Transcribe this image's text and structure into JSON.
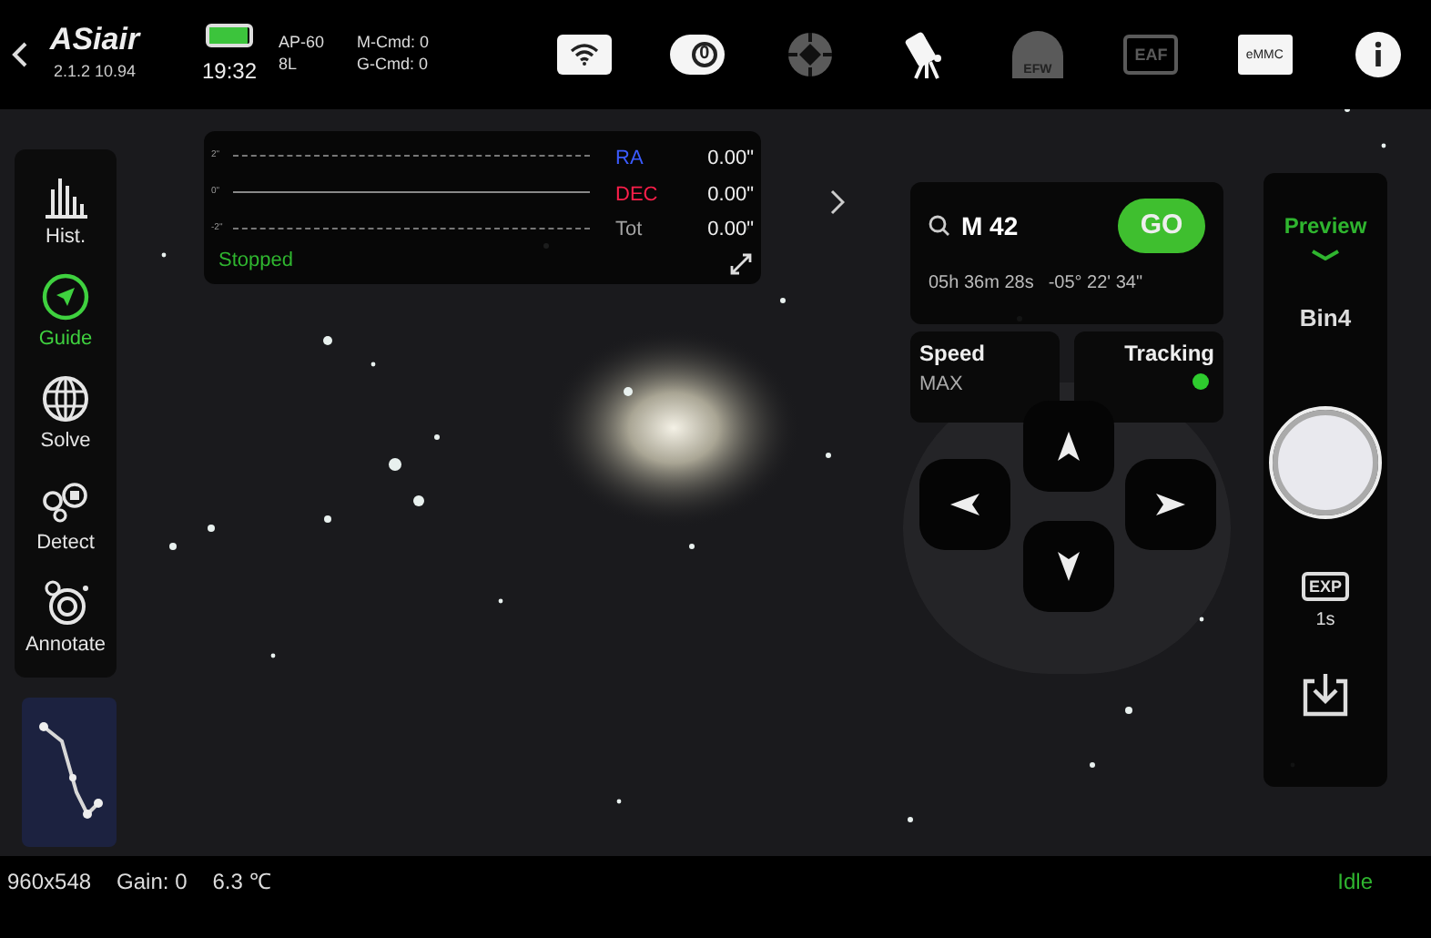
{
  "header": {
    "logo": "ASiair",
    "version": "2.1.2 10.94",
    "battery": {
      "level": 0.95
    },
    "time": "19:32",
    "device_info": [
      "AP-60",
      "8L"
    ],
    "commands": [
      "M-Cmd: 0",
      "G-Cmd: 0"
    ]
  },
  "toolbar": [
    {
      "kind": "wifi",
      "active": true
    },
    {
      "kind": "camera",
      "label": "0",
      "active": true
    },
    {
      "kind": "guider",
      "active": false
    },
    {
      "kind": "mount",
      "active": true
    },
    {
      "kind": "efw",
      "label": "EFW",
      "active": false
    },
    {
      "kind": "eaf",
      "label": "EAF",
      "active": false
    },
    {
      "kind": "storage",
      "label": "eMMC",
      "active": true
    },
    {
      "kind": "info",
      "active": true
    }
  ],
  "tools": [
    {
      "kind": "histogram",
      "label": "Hist.",
      "selected": false
    },
    {
      "kind": "guide",
      "label": "Guide",
      "selected": true
    },
    {
      "kind": "solve",
      "label": "Solve",
      "selected": false
    },
    {
      "kind": "detect",
      "label": "Detect",
      "selected": false
    },
    {
      "kind": "annotate",
      "label": "Annotate",
      "selected": false
    }
  ],
  "guide_graph": {
    "y_labels": [
      "2\"",
      "0\"",
      "-2\""
    ],
    "status": "Stopped",
    "stats": [
      {
        "label": "RA",
        "value": "0.00\"",
        "color": "#3b5bff"
      },
      {
        "label": "DEC",
        "value": "0.00\"",
        "color": "#ff1f4b"
      },
      {
        "label": "Tot",
        "value": "0.00\"",
        "color": "#a3a3a3"
      }
    ]
  },
  "goto": {
    "target": "M 42",
    "button": "GO",
    "ra": "05h 36m 28s",
    "dec": "-05° 22' 34\""
  },
  "speed": {
    "label": "Speed",
    "value": "MAX"
  },
  "tracking": {
    "label": "Tracking",
    "on": true
  },
  "preview": {
    "mode": "Preview",
    "bin": "Bin4",
    "exposure_label": "EXP",
    "exposure": "1s"
  },
  "status_bar": {
    "resolution": "960x548",
    "gain": "Gain: 0",
    "temperature": "6.3 ℃",
    "state": "Idle"
  }
}
